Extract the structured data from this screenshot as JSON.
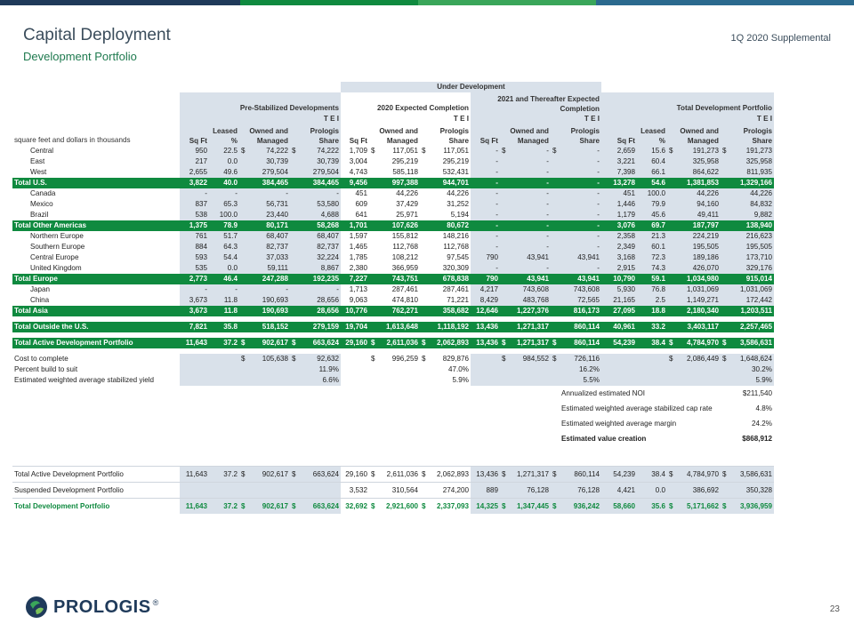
{
  "header": {
    "title": "Capital Deployment",
    "subtitle": "Development Portfolio",
    "supplement": "1Q 2020 Supplemental",
    "page_number": "23",
    "logo_text": "PROLOGIS",
    "logo_mark": "®"
  },
  "brand_colors": {
    "green": "#0f8a3f",
    "navy": "#1f3a5a",
    "blue_gray": "#d9e1ea"
  },
  "table": {
    "group_under": "Under Development",
    "group_prestab": "Pre-Stabilized Developments",
    "group_2020": "2020 Expected Completion",
    "group_2021": "2021 and Thereafter Expected Completion",
    "group_total": "Total Development Portfolio",
    "tei": "T E I",
    "units_label": "square feet and dollars in thousands",
    "col_sqft": "Sq Ft",
    "col_leased": "Leased %",
    "col_owned": "Owned and Managed",
    "col_share": "Prologis Share",
    "rows": [
      {
        "label": "Central",
        "type": "item",
        "c": [
          "950",
          "22.5",
          "$",
          "74,222",
          "$",
          "74,222",
          "1,709",
          "$",
          "117,051",
          "$",
          "117,051",
          "-",
          "$",
          "-",
          "$",
          "-",
          "2,659",
          "15.6",
          "$",
          "191,273",
          "$",
          "191,273"
        ]
      },
      {
        "label": "East",
        "type": "item",
        "c": [
          "217",
          "0.0",
          "",
          "30,739",
          "",
          "30,739",
          "3,004",
          "",
          "295,219",
          "",
          "295,219",
          "-",
          "",
          "-",
          "",
          "-",
          "3,221",
          "60.4",
          "",
          "325,958",
          "",
          "325,958"
        ]
      },
      {
        "label": "West",
        "type": "item",
        "c": [
          "2,655",
          "49.6",
          "",
          "279,504",
          "",
          "279,504",
          "4,743",
          "",
          "585,118",
          "",
          "532,431",
          "-",
          "",
          "-",
          "",
          "-",
          "7,398",
          "66.1",
          "",
          "864,622",
          "",
          "811,935"
        ]
      },
      {
        "label": "Total U.S.",
        "type": "total",
        "c": [
          "3,822",
          "40.0",
          "",
          "384,465",
          "",
          "384,465",
          "9,456",
          "",
          "997,388",
          "",
          "944,701",
          "-",
          "",
          "-",
          "",
          "-",
          "13,278",
          "54.6",
          "",
          "1,381,853",
          "",
          "1,329,166"
        ]
      },
      {
        "label": "Canada",
        "type": "item",
        "c": [
          "-",
          "-",
          "",
          "-",
          "",
          "-",
          "451",
          "",
          "44,226",
          "",
          "44,226",
          "-",
          "",
          "-",
          "",
          "-",
          "451",
          "100.0",
          "",
          "44,226",
          "",
          "44,226"
        ]
      },
      {
        "label": "Mexico",
        "type": "item",
        "c": [
          "837",
          "65.3",
          "",
          "56,731",
          "",
          "53,580",
          "609",
          "",
          "37,429",
          "",
          "31,252",
          "-",
          "",
          "-",
          "",
          "-",
          "1,446",
          "79.9",
          "",
          "94,160",
          "",
          "84,832"
        ]
      },
      {
        "label": "Brazil",
        "type": "item",
        "c": [
          "538",
          "100.0",
          "",
          "23,440",
          "",
          "4,688",
          "641",
          "",
          "25,971",
          "",
          "5,194",
          "-",
          "",
          "-",
          "",
          "-",
          "1,179",
          "45.6",
          "",
          "49,411",
          "",
          "9,882"
        ]
      },
      {
        "label": "Total Other Americas",
        "type": "total",
        "c": [
          "1,375",
          "78.9",
          "",
          "80,171",
          "",
          "58,268",
          "1,701",
          "",
          "107,626",
          "",
          "80,672",
          "-",
          "",
          "-",
          "",
          "-",
          "3,076",
          "69.7",
          "",
          "187,797",
          "",
          "138,940"
        ]
      },
      {
        "label": "Northern Europe",
        "type": "item",
        "c": [
          "761",
          "51.7",
          "",
          "68,407",
          "",
          "68,407",
          "1,597",
          "",
          "155,812",
          "",
          "148,216",
          "-",
          "",
          "-",
          "",
          "-",
          "2,358",
          "21.3",
          "",
          "224,219",
          "",
          "216,623"
        ]
      },
      {
        "label": "Southern Europe",
        "type": "item",
        "c": [
          "884",
          "64.3",
          "",
          "82,737",
          "",
          "82,737",
          "1,465",
          "",
          "112,768",
          "",
          "112,768",
          "-",
          "",
          "-",
          "",
          "-",
          "2,349",
          "60.1",
          "",
          "195,505",
          "",
          "195,505"
        ]
      },
      {
        "label": "Central Europe",
        "type": "item",
        "c": [
          "593",
          "54.4",
          "",
          "37,033",
          "",
          "32,224",
          "1,785",
          "",
          "108,212",
          "",
          "97,545",
          "790",
          "",
          "43,941",
          "",
          "43,941",
          "3,168",
          "72.3",
          "",
          "189,186",
          "",
          "173,710"
        ]
      },
      {
        "label": "United Kingdom",
        "type": "item",
        "c": [
          "535",
          "0.0",
          "",
          "59,111",
          "",
          "8,867",
          "2,380",
          "",
          "366,959",
          "",
          "320,309",
          "-",
          "",
          "-",
          "",
          "-",
          "2,915",
          "74.3",
          "",
          "426,070",
          "",
          "329,176"
        ]
      },
      {
        "label": "Total Europe",
        "type": "total",
        "c": [
          "2,773",
          "46.4",
          "",
          "247,288",
          "",
          "192,235",
          "7,227",
          "",
          "743,751",
          "",
          "678,838",
          "790",
          "",
          "43,941",
          "",
          "43,941",
          "10,790",
          "59.1",
          "",
          "1,034,980",
          "",
          "915,014"
        ]
      },
      {
        "label": "Japan",
        "type": "item",
        "c": [
          "-",
          "-",
          "",
          "-",
          "",
          "-",
          "1,713",
          "",
          "287,461",
          "",
          "287,461",
          "4,217",
          "",
          "743,608",
          "",
          "743,608",
          "5,930",
          "76.8",
          "",
          "1,031,069",
          "",
          "1,031,069"
        ]
      },
      {
        "label": "China",
        "type": "item",
        "c": [
          "3,673",
          "11.8",
          "",
          "190,693",
          "",
          "28,656",
          "9,063",
          "",
          "474,810",
          "",
          "71,221",
          "8,429",
          "",
          "483,768",
          "",
          "72,565",
          "21,165",
          "2.5",
          "",
          "1,149,271",
          "",
          "172,442"
        ]
      },
      {
        "label": "Total Asia",
        "type": "total",
        "c": [
          "3,673",
          "11.8",
          "",
          "190,693",
          "",
          "28,656",
          "10,776",
          "",
          "762,271",
          "",
          "358,682",
          "12,646",
          "",
          "1,227,376",
          "",
          "816,173",
          "27,095",
          "18.8",
          "",
          "2,180,340",
          "",
          "1,203,511"
        ]
      },
      {
        "type": "spacer"
      },
      {
        "label": "Total Outside the U.S.",
        "type": "total",
        "c": [
          "7,821",
          "35.8",
          "",
          "518,152",
          "",
          "279,159",
          "19,704",
          "",
          "1,613,648",
          "",
          "1,118,192",
          "13,436",
          "",
          "1,271,317",
          "",
          "860,114",
          "40,961",
          "33.2",
          "",
          "3,403,117",
          "",
          "2,257,465"
        ]
      },
      {
        "type": "spacer"
      },
      {
        "label": "Total Active Development Portfolio",
        "type": "total",
        "c": [
          "11,643",
          "37.2",
          "$",
          "902,617",
          "$",
          "663,624",
          "29,160",
          "$",
          "2,611,036",
          "$",
          "2,062,893",
          "13,436",
          "$",
          "1,271,317",
          "$",
          "860,114",
          "54,239",
          "38.4",
          "$",
          "4,784,970",
          "$",
          "3,586,631"
        ]
      },
      {
        "type": "spacer"
      },
      {
        "label": "Cost to complete",
        "type": "plain",
        "c": [
          "",
          "",
          "$",
          "105,638",
          "$",
          "92,632",
          "",
          "$",
          "996,259",
          "$",
          "829,876",
          "",
          "$",
          "984,552",
          "$",
          "726,116",
          "",
          "",
          "$",
          "2,086,449",
          "$",
          "1,648,624"
        ]
      },
      {
        "label": "Percent build to suit",
        "type": "plain",
        "c": [
          "",
          "",
          "",
          "",
          "",
          "11.9%",
          "",
          "",
          "",
          "",
          "47.0%",
          "",
          "",
          "",
          "",
          "16.2%",
          "",
          "",
          "",
          "",
          "",
          "30.2%"
        ]
      },
      {
        "label": "Estimated weighted average stabilized yield",
        "type": "plain",
        "c": [
          "",
          "",
          "",
          "",
          "",
          "6.6%",
          "",
          "",
          "",
          "",
          "5.9%",
          "",
          "",
          "",
          "",
          "5.5%",
          "",
          "",
          "",
          "",
          "",
          "5.9%"
        ]
      }
    ],
    "value_creation": [
      {
        "label": "Annualized estimated NOI",
        "value": "$211,540",
        "bold": false
      },
      {
        "label": "Estimated weighted average stabilized cap rate",
        "value": "4.8%",
        "bold": false
      },
      {
        "label": "Estimated weighted average margin",
        "value": "24.2%",
        "bold": false
      },
      {
        "label": "Estimated value creation",
        "value": "$868,912",
        "bold": true
      }
    ],
    "bottom_rows": [
      {
        "label": "Total Active Development Portfolio",
        "type": "plain",
        "c": [
          "11,643",
          "37.2",
          "$",
          "902,617",
          "$",
          "663,624",
          "29,160",
          "$",
          "2,611,036",
          "$",
          "2,062,893",
          "13,436",
          "$",
          "1,271,317",
          "$",
          "860,114",
          "54,239",
          "38.4",
          "$",
          "4,784,970",
          "$",
          "3,586,631"
        ]
      },
      {
        "label": "Suspended Development Portfolio",
        "type": "plain",
        "c": [
          "",
          "",
          "",
          "",
          "",
          "",
          "3,532",
          "",
          "310,564",
          "",
          "274,200",
          "889",
          "",
          "76,128",
          "",
          "76,128",
          "4,421",
          "0.0",
          "",
          "386,692",
          "",
          "350,328"
        ]
      },
      {
        "label": "Total  Development Portfolio",
        "type": "grandtotal",
        "c": [
          "11,643",
          "37.2",
          "$",
          "902,617",
          "$",
          "663,624",
          "32,692",
          "$",
          "2,921,600",
          "$",
          "2,337,093",
          "14,325",
          "$",
          "1,347,445",
          "$",
          "936,242",
          "58,660",
          "35.6",
          "$",
          "5,171,662",
          "$",
          "3,936,959"
        ]
      }
    ]
  }
}
